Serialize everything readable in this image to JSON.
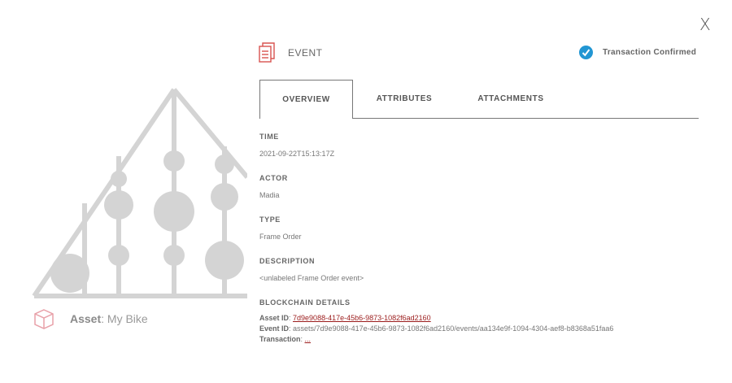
{
  "close_label": "X",
  "event": {
    "title": "EVENT",
    "status": "Transaction Confirmed"
  },
  "tabs": [
    {
      "label": "OVERVIEW"
    },
    {
      "label": "ATTRIBUTES"
    },
    {
      "label": "ATTACHMENTS"
    }
  ],
  "overview": {
    "time_label": "TIME",
    "time_value": "2021-09-22T15:13:17Z",
    "actor_label": "ACTOR",
    "actor_value": "Madia",
    "type_label": "TYPE",
    "type_value": "Frame Order",
    "description_label": "DESCRIPTION",
    "description_value": "<unlabeled Frame Order event>",
    "blockchain_label": "BLOCKCHAIN DETAILS",
    "asset_id_label": "Asset ID",
    "asset_id_value": "7d9e9088-417e-45b6-9873-1082f6ad2160",
    "event_id_label": "Event ID",
    "event_id_value": "assets/7d9e9088-417e-45b6-9873-1082f6ad2160/events/aa134e9f-1094-4304-aef8-b8368a51faa6",
    "transaction_label": "Transaction",
    "transaction_value": "..."
  },
  "asset": {
    "label": "Asset",
    "name": "My Bike"
  },
  "colors": {
    "accent_red": "#d9534f",
    "check_blue": "#2196d3",
    "link": "#9b1c1c",
    "art_gray": "#d4d4d4"
  },
  "icons": {
    "close": "close-icon",
    "event": "document-icon",
    "confirmed": "check-circle-icon",
    "asset": "box-icon"
  }
}
